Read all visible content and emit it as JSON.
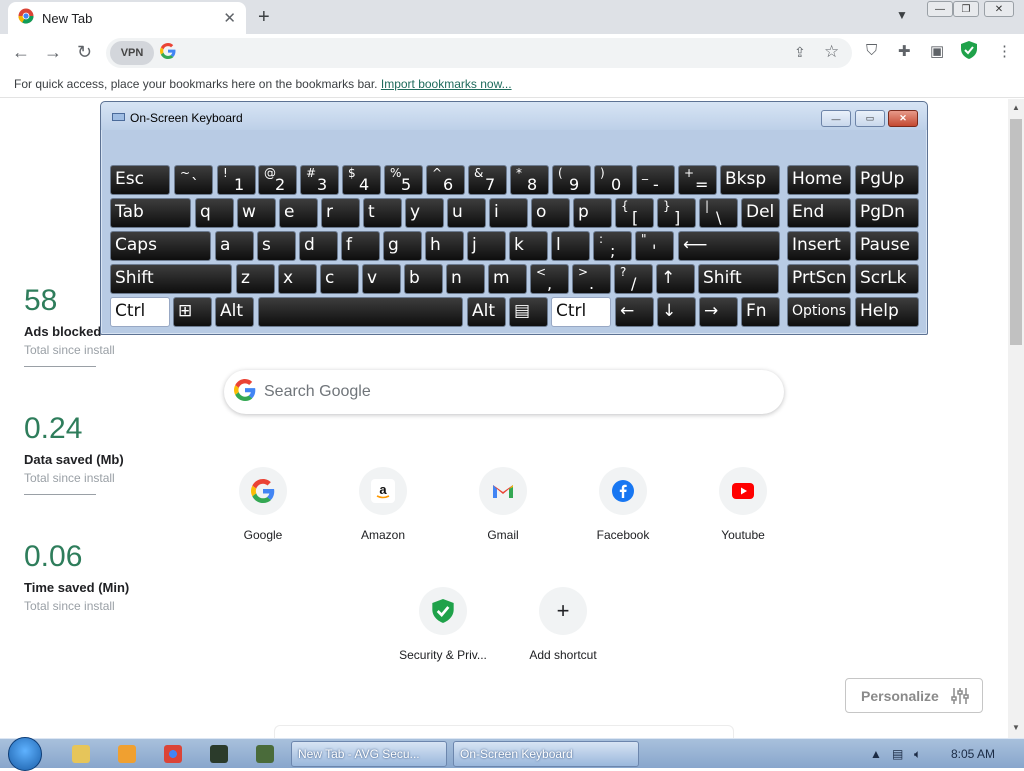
{
  "browser": {
    "tab_title": "New Tab",
    "tab_close": "✕",
    "new_tab": "+",
    "window_controls": [
      "—",
      "❐",
      "✕"
    ]
  },
  "toolbar": {
    "vpn_label": "VPN",
    "omnibox_value": "",
    "bookmarks_prompt": "For quick access, place your bookmarks here on the bookmarks bar.",
    "import_link": "Import bookmarks now..."
  },
  "stats": [
    {
      "value": "58",
      "label": "Ads blocked",
      "sub": "Total since install"
    },
    {
      "value": "0.24",
      "label": "Data saved (Mb)",
      "sub": "Total since install"
    },
    {
      "value": "0.06",
      "label": "Time saved (Min)",
      "sub": "Total since install"
    }
  ],
  "search": {
    "placeholder": "Search Google"
  },
  "shortcuts": [
    {
      "name": "Google",
      "icon": "google-icon"
    },
    {
      "name": "Amazon",
      "icon": "amazon-icon"
    },
    {
      "name": "Gmail",
      "icon": "gmail-icon"
    },
    {
      "name": "Facebook",
      "icon": "facebook-icon"
    },
    {
      "name": "Youtube",
      "icon": "youtube-icon"
    },
    {
      "name": "Security & Priv...",
      "icon": "shield-icon"
    },
    {
      "name": "Add shortcut",
      "icon": "plus-icon"
    }
  ],
  "personalize_label": "Personalize",
  "osk": {
    "title": "On-Screen Keyboard",
    "row1": [
      {
        "label": "Esc"
      },
      {
        "top": "~",
        "bot": "`"
      },
      {
        "top": "!",
        "bot": "1"
      },
      {
        "top": "@",
        "bot": "2"
      },
      {
        "top": "#",
        "bot": "3"
      },
      {
        "top": "$",
        "bot": "4"
      },
      {
        "top": "%",
        "bot": "5"
      },
      {
        "top": "^",
        "bot": "6"
      },
      {
        "top": "&",
        "bot": "7"
      },
      {
        "top": "*",
        "bot": "8"
      },
      {
        "top": "(",
        "bot": "9"
      },
      {
        "top": ")",
        "bot": "0"
      },
      {
        "top": "_",
        "bot": "-"
      },
      {
        "top": "+",
        "bot": "="
      },
      {
        "label": "Bksp"
      },
      {
        "label": "Home"
      },
      {
        "label": "PgUp"
      }
    ],
    "row2": [
      {
        "label": "Tab"
      },
      {
        "label": "q"
      },
      {
        "label": "w"
      },
      {
        "label": "e"
      },
      {
        "label": "r"
      },
      {
        "label": "t"
      },
      {
        "label": "y"
      },
      {
        "label": "u"
      },
      {
        "label": "i"
      },
      {
        "label": "o"
      },
      {
        "label": "p"
      },
      {
        "top": "{",
        "bot": "["
      },
      {
        "top": "}",
        "bot": "]"
      },
      {
        "top": "|",
        "bot": "\\"
      },
      {
        "label": "Del"
      },
      {
        "label": "End"
      },
      {
        "label": "PgDn"
      }
    ],
    "row3": [
      {
        "label": "Caps"
      },
      {
        "label": "a"
      },
      {
        "label": "s"
      },
      {
        "label": "d"
      },
      {
        "label": "f"
      },
      {
        "label": "g"
      },
      {
        "label": "h"
      },
      {
        "label": "j"
      },
      {
        "label": "k"
      },
      {
        "label": "l"
      },
      {
        "top": ":",
        "bot": ";"
      },
      {
        "top": "\"",
        "bot": "'"
      },
      {
        "label": "⟵"
      },
      {
        "label": "Insert"
      },
      {
        "label": "Pause"
      }
    ],
    "row4": [
      {
        "label": "Shift"
      },
      {
        "label": "z"
      },
      {
        "label": "x"
      },
      {
        "label": "c"
      },
      {
        "label": "v"
      },
      {
        "label": "b"
      },
      {
        "label": "n"
      },
      {
        "label": "m"
      },
      {
        "top": "<",
        "bot": ","
      },
      {
        "top": ">",
        "bot": "."
      },
      {
        "top": "?",
        "bot": "/"
      },
      {
        "label": "↑"
      },
      {
        "label": "Shift"
      },
      {
        "label": "PrtScn"
      },
      {
        "label": "ScrLk"
      }
    ],
    "row5": [
      {
        "label": "Ctrl",
        "pressed": true
      },
      {
        "label": "⊞"
      },
      {
        "label": "Alt"
      },
      {
        "label": ""
      },
      {
        "label": "Alt"
      },
      {
        "label": "▤"
      },
      {
        "label": "Ctrl",
        "pressed": true
      },
      {
        "label": "←"
      },
      {
        "label": "↓"
      },
      {
        "label": "→"
      },
      {
        "label": "Fn"
      },
      {
        "label": "Options"
      },
      {
        "label": "Help"
      }
    ]
  },
  "taskbar": {
    "tasks": [
      "New Tab - AVG Secu...",
      "On-Screen Keyboard"
    ],
    "clock": "8:05 AM"
  }
}
